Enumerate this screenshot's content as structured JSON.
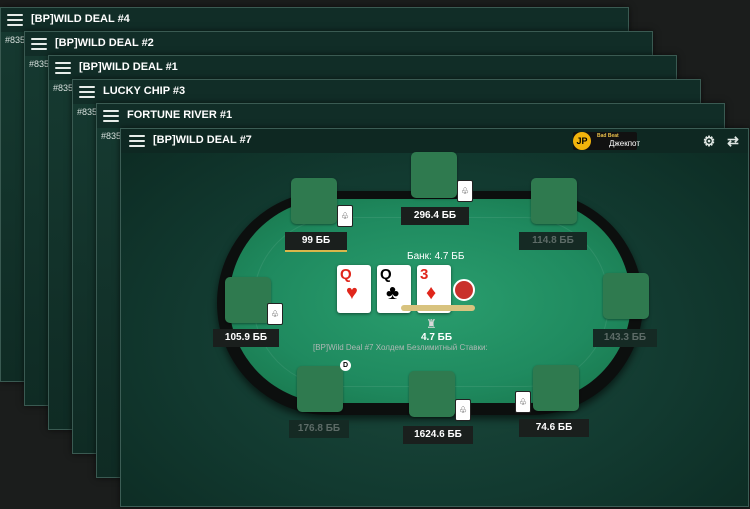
{
  "background_windows": [
    {
      "title": "[BP]WILD DEAL #4",
      "hand_id": "#835"
    },
    {
      "title": "[BP]WILD DEAL #2",
      "hand_id": "#835"
    },
    {
      "title": "[BP]WILD DEAL #1",
      "hand_id": "#835"
    },
    {
      "title": "LUCKY CHIP #3",
      "hand_id": "#835"
    },
    {
      "title": "FORTUNE RIVER #1",
      "hand_id": "#835"
    }
  ],
  "main_window": {
    "title": "[BP]WILD DEAL #7",
    "jackpot": {
      "top_text": "Bad Beat",
      "label": "Джекпот"
    },
    "table_info": "[BP]Wild Deal #7 Холдем Безлимитный Ставки:",
    "pot_label": "Банк: 4.7 ББ",
    "pot_value": "4.7 ББ",
    "board_cards": [
      {
        "rank": "Q",
        "suit": "♥",
        "color": "red"
      },
      {
        "rank": "Q",
        "suit": "♣",
        "color": "black"
      },
      {
        "rank": "3",
        "suit": "♦",
        "color": "red"
      }
    ],
    "seats": [
      {
        "stack": "296.4 ББ",
        "active": true
      },
      {
        "stack": "99 ББ",
        "active": true
      },
      {
        "stack": "114.8 ББ",
        "active": false
      },
      {
        "stack": "105.9 ББ",
        "active": true
      },
      {
        "stack": "143.3 ББ",
        "active": false
      },
      {
        "stack": "176.8 ББ",
        "active": false
      },
      {
        "stack": "1624.6 ББ",
        "active": true
      },
      {
        "stack": "74.6 ББ",
        "active": true
      }
    ],
    "dealer_button": "D"
  }
}
